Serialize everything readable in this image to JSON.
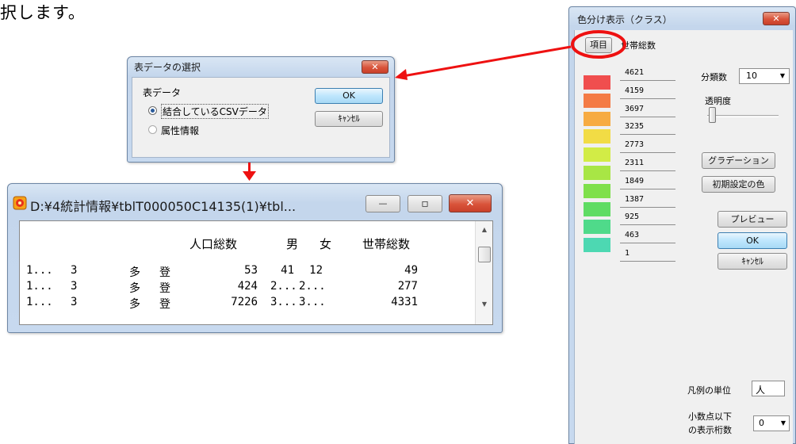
{
  "document": {
    "text": "択します。"
  },
  "dialog_table_select": {
    "title": "表データの選択",
    "group_label": "表データ",
    "options": [
      "結合しているCSVデータ",
      "属性情報"
    ],
    "selected_index": 0,
    "ok_label": "OK",
    "cancel_label": "ｷｬﾝｾﾙ",
    "close_glyph": "✕"
  },
  "table_window": {
    "title": "D:¥4統計情報¥tblT000050C14135(1)¥tbl...",
    "headers": [
      "人口総数",
      "男",
      "女",
      "世帯総数"
    ],
    "rows": [
      [
        "1...",
        "3",
        "多",
        "登",
        "53",
        "41",
        "12",
        "49"
      ],
      [
        "1...",
        "3",
        "多",
        "登",
        "424",
        "2...",
        "2...",
        "277"
      ],
      [
        "1...",
        "3",
        "多",
        "登",
        "7226",
        "3...",
        "3...",
        "4331"
      ]
    ],
    "minimize_glyph": "—",
    "maximize_glyph": "▫",
    "close_glyph": "✕",
    "scroll_up_glyph": "▲",
    "scroll_down_glyph": "▼"
  },
  "color_panel": {
    "title": "色分け表示（クラス）",
    "close_glyph": "✕",
    "item_button_label": "項目",
    "item_value": "世帯総数",
    "class_values": [
      "4621",
      "4159",
      "3697",
      "3235",
      "2773",
      "2311",
      "1849",
      "1387",
      "925",
      "463",
      "1"
    ],
    "swatch_colors": [
      "#f04e4e",
      "#f47b45",
      "#f7ab42",
      "#f2dc45",
      "#d2ec46",
      "#a8e645",
      "#7fe04b",
      "#5fdc63",
      "#4fda8a",
      "#4dd8b2"
    ],
    "class_count_label": "分類数",
    "class_count_value": "10",
    "transparency_label": "透明度",
    "gradation_label": "グラデーション",
    "initial_colors_label": "初期設定の色",
    "preview_label": "プレビュー",
    "ok_label": "OK",
    "cancel_label": "ｷｬﾝｾﾙ",
    "legend_unit_label": "凡例の単位",
    "legend_unit_value": "人",
    "decimals_label_line1": "小数点以下",
    "decimals_label_line2": "の表示桁数",
    "decimals_value": "0",
    "dropdown_glyph": "▼"
  },
  "colors": {
    "highlight_red": "#e11111",
    "titlebar": "#c7d9ef",
    "close_button": "#d9533a"
  }
}
